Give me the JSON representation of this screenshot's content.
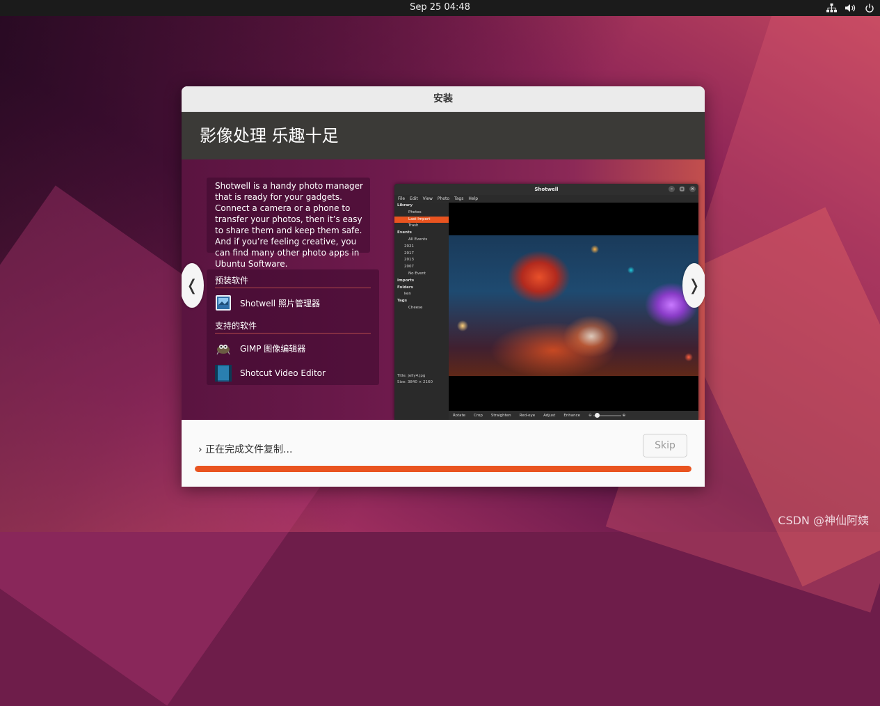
{
  "topbar": {
    "clock": "Sep 25  04:48",
    "icons": [
      "network-icon",
      "volume-icon",
      "power-icon"
    ]
  },
  "window": {
    "title": "安装",
    "heading": "影像处理 乐趣十足",
    "slide": {
      "description": "Shotwell is a handy photo manager that is ready for your gadgets. Connect a camera or a phone to transfer your photos, then it’s easy to share them and keep them safe. And if you’re feeling creative, you can find many other photo apps in Ubuntu Software.",
      "preinstalled_label": "预装软件",
      "preinstalled": [
        {
          "name": "Shotwell 照片管理器",
          "icon": "shotwell-icon"
        }
      ],
      "supported_label": "支持的软件",
      "supported": [
        {
          "name": "GIMP 图像编辑器",
          "icon": "gimp-icon"
        },
        {
          "name": "Shotcut Video Editor",
          "icon": "shotcut-icon"
        }
      ],
      "prev": "❬",
      "next": "❭",
      "screenshot": {
        "title": "Shotwell",
        "menu": [
          "File",
          "Edit",
          "View",
          "Photo",
          "Tags",
          "Help"
        ],
        "sidebar": [
          {
            "label": "Library",
            "level": "h"
          },
          {
            "label": "Photos",
            "level": "i2"
          },
          {
            "label": "Last Import",
            "level": "i2",
            "selected": true
          },
          {
            "label": "Trash",
            "level": "i2"
          },
          {
            "label": "Events",
            "level": "h"
          },
          {
            "label": "All Events",
            "level": "i2"
          },
          {
            "label": "2021",
            "level": "i1"
          },
          {
            "label": "2017",
            "level": "i1"
          },
          {
            "label": "2013",
            "level": "i1"
          },
          {
            "label": "2007",
            "level": "i1"
          },
          {
            "label": "No Event",
            "level": "i2"
          },
          {
            "label": "Imports",
            "level": "h"
          },
          {
            "label": "Folders",
            "level": "h"
          },
          {
            "label": "ken",
            "level": "i1"
          },
          {
            "label": "Tags",
            "level": "h"
          },
          {
            "label": "Cheese",
            "level": "i2"
          }
        ],
        "info_title_label": "Title:",
        "info_title": "jelly4.jpg",
        "info_size_label": "Size:",
        "info_size": "3840 × 2160",
        "tools": [
          "Rotate",
          "Crop",
          "Straighten",
          "Red-eye",
          "Adjust",
          "Enhance"
        ]
      }
    },
    "status": "正在完成文件复制...",
    "skip_label": "Skip",
    "progress_percent": 100
  },
  "watermark": "CSDN @神仙阿姨"
}
